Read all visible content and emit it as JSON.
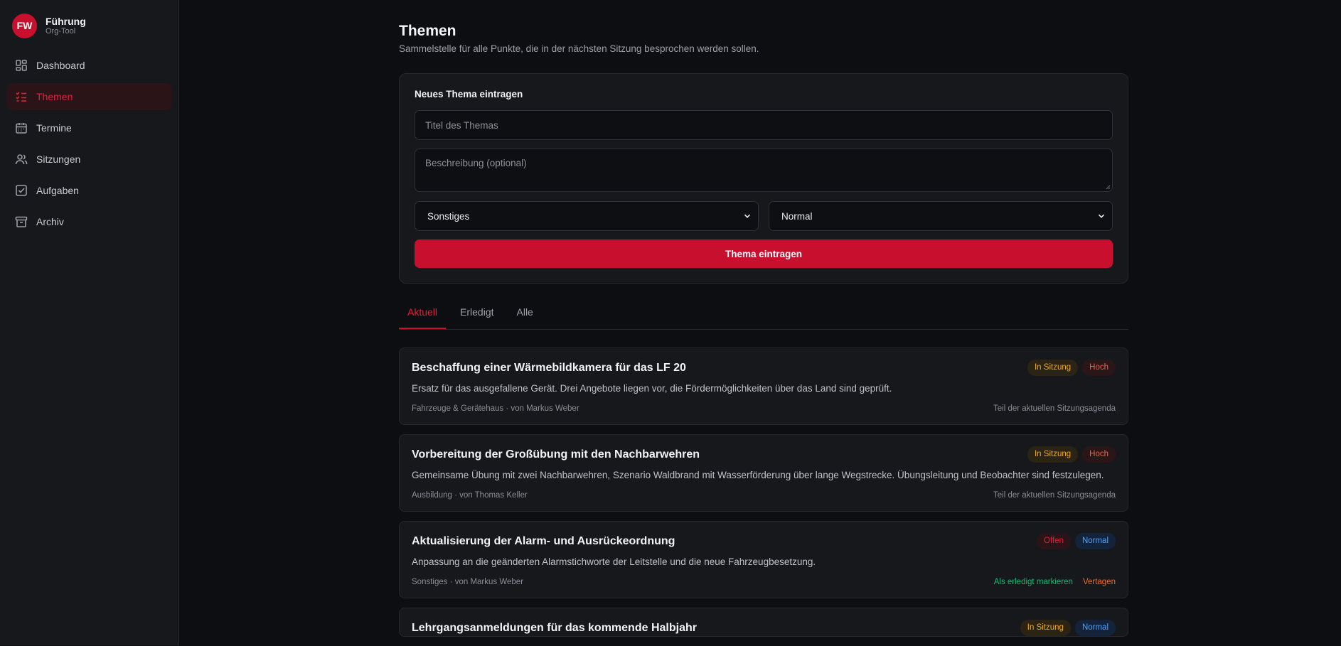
{
  "brand": {
    "initials": "FW",
    "title": "Führung",
    "subtitle": "Org-Tool"
  },
  "nav": [
    {
      "label": "Dashboard",
      "icon": "dashboard-icon"
    },
    {
      "label": "Themen",
      "icon": "list-check-icon",
      "active": true
    },
    {
      "label": "Termine",
      "icon": "calendar-icon"
    },
    {
      "label": "Sitzungen",
      "icon": "users-icon"
    },
    {
      "label": "Aufgaben",
      "icon": "checkbox-icon"
    },
    {
      "label": "Archiv",
      "icon": "archive-icon"
    }
  ],
  "page": {
    "title": "Themen",
    "subtitle": "Sammelstelle für alle Punkte, die in der nächsten Sitzung besprochen werden sollen."
  },
  "form": {
    "heading": "Neues Thema eintragen",
    "title_placeholder": "Titel des Themas",
    "description_placeholder": "Beschreibung (optional)",
    "category_value": "Sonstiges",
    "priority_value": "Normal",
    "submit_label": "Thema eintragen"
  },
  "tabs": [
    {
      "label": "Aktuell",
      "active": true
    },
    {
      "label": "Erledigt"
    },
    {
      "label": "Alle"
    }
  ],
  "items": [
    {
      "title": "Beschaffung einer Wärmebildkamera für das LF 20",
      "status": "In Sitzung",
      "priority": "Hoch",
      "description": "Ersatz für das ausgefallene Gerät. Drei Angebote liegen vor, die Fördermöglichkeiten über das Land sind geprüft.",
      "meta": "Fahrzeuge & Gerätehaus · von Markus Weber",
      "note": "Teil der aktuellen Sitzungsagenda"
    },
    {
      "title": "Vorbereitung der Großübung mit den Nachbarwehren",
      "status": "In Sitzung",
      "priority": "Hoch",
      "description": "Gemeinsame Übung mit zwei Nachbarwehren, Szenario Waldbrand mit Wasserförderung über lange Wegstrecke. Übungsleitung und Beobachter sind festzulegen.",
      "meta": "Ausbildung · von Thomas Keller",
      "note": "Teil der aktuellen Sitzungsagenda"
    },
    {
      "title": "Aktualisierung der Alarm- und Ausrückeordnung",
      "status": "Offen",
      "priority": "Normal",
      "description": "Anpassung an die geänderten Alarmstichworte der Leitstelle und die neue Fahrzeugbesetzung.",
      "meta": "Sonstiges · von Markus Weber",
      "action_done": "Als erledigt markieren",
      "action_later": "Vertagen"
    },
    {
      "title": "Lehrgangsanmeldungen für das kommende Halbjahr",
      "status": "In Sitzung",
      "priority": "Normal"
    }
  ],
  "colors": {
    "accent": "#c8102e",
    "background": "#0d0e11",
    "sidebar": "#17181c"
  }
}
